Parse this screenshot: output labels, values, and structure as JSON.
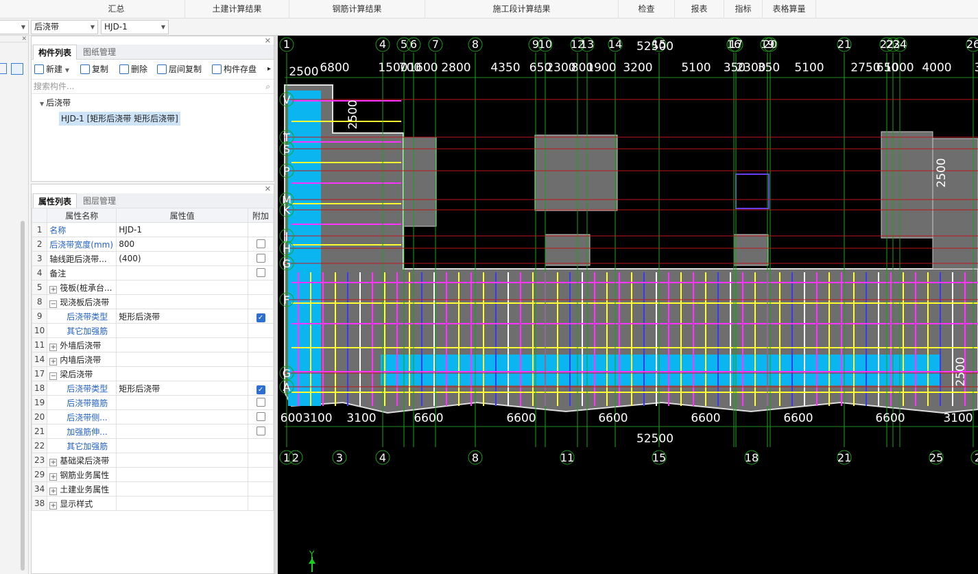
{
  "menu": [
    "汇总",
    "土建计算结果",
    "钢筋计算结果",
    "施工段计算结果",
    "检查",
    "报表",
    "指标",
    "表格算量"
  ],
  "toolbar2": {
    "combo1": "",
    "combo2": "后浇带",
    "combo3": "HJD-1"
  },
  "component_panel": {
    "tabs": [
      "构件列表",
      "图纸管理"
    ],
    "buttons": [
      "新建",
      "复制",
      "删除",
      "层间复制",
      "构件存盘"
    ],
    "search_placeholder": "搜索构件...",
    "tree_root": "后浇带",
    "tree_child": "HJD-1 [矩形后浇带 矩形后浇带]"
  },
  "property_panel": {
    "tabs": [
      "属性列表",
      "图层管理"
    ],
    "headers": [
      "属性名称",
      "属性值",
      "附加"
    ],
    "rows": [
      {
        "n": "1",
        "name": "名称",
        "value": "HJD-1",
        "blue": true,
        "indent": false,
        "exp": "",
        "cb": null
      },
      {
        "n": "2",
        "name": "后浇带宽度(mm)",
        "value": "800",
        "blue": true,
        "indent": false,
        "exp": "",
        "cb": false
      },
      {
        "n": "3",
        "name": "轴线距后浇带...",
        "value": "(400)",
        "blue": false,
        "indent": false,
        "exp": "",
        "cb": false
      },
      {
        "n": "4",
        "name": "备注",
        "value": "",
        "blue": false,
        "indent": false,
        "exp": "",
        "cb": false
      },
      {
        "n": "5",
        "name": "筏板(桩承台...",
        "value": "",
        "blue": false,
        "indent": false,
        "exp": "+",
        "cb": null
      },
      {
        "n": "8",
        "name": "现浇板后浇带",
        "value": "",
        "blue": false,
        "indent": false,
        "exp": "−",
        "cb": null
      },
      {
        "n": "9",
        "name": "后浇带类型",
        "value": "矩形后浇带",
        "blue": true,
        "indent": true,
        "exp": "",
        "cb": true
      },
      {
        "n": "10",
        "name": "其它加强筋",
        "value": "",
        "blue": true,
        "indent": true,
        "exp": "",
        "cb": null
      },
      {
        "n": "11",
        "name": "外墙后浇带",
        "value": "",
        "blue": false,
        "indent": false,
        "exp": "+",
        "cb": null
      },
      {
        "n": "14",
        "name": "内墙后浇带",
        "value": "",
        "blue": false,
        "indent": false,
        "exp": "+",
        "cb": null
      },
      {
        "n": "17",
        "name": "梁后浇带",
        "value": "",
        "blue": false,
        "indent": false,
        "exp": "−",
        "cb": null
      },
      {
        "n": "18",
        "name": "后浇带类型",
        "value": "矩形后浇带",
        "blue": true,
        "indent": true,
        "exp": "",
        "cb": true
      },
      {
        "n": "19",
        "name": "后浇带箍筋",
        "value": "",
        "blue": true,
        "indent": true,
        "exp": "",
        "cb": false
      },
      {
        "n": "20",
        "name": "后浇带侧...",
        "value": "",
        "blue": true,
        "indent": true,
        "exp": "",
        "cb": false
      },
      {
        "n": "21",
        "name": "加强筋伸...",
        "value": "",
        "blue": true,
        "indent": true,
        "exp": "",
        "cb": false
      },
      {
        "n": "22",
        "name": "其它加强筋",
        "value": "",
        "blue": true,
        "indent": true,
        "exp": "",
        "cb": null
      },
      {
        "n": "23",
        "name": "基础梁后浇带",
        "value": "",
        "blue": false,
        "indent": false,
        "exp": "+",
        "cb": null
      },
      {
        "n": "29",
        "name": "钢筋业务属性",
        "value": "",
        "blue": false,
        "indent": false,
        "exp": "+",
        "cb": null
      },
      {
        "n": "34",
        "name": "土建业务属性",
        "value": "",
        "blue": false,
        "indent": false,
        "exp": "+",
        "cb": null
      },
      {
        "n": "38",
        "name": "显示样式",
        "value": "",
        "blue": false,
        "indent": false,
        "exp": "+",
        "cb": null
      }
    ]
  },
  "canvas": {
    "top_axes": [
      "1",
      "4",
      "5",
      "6",
      "7",
      "8",
      "9",
      "10",
      "12",
      "13",
      "14",
      "15",
      "16",
      "17",
      "19",
      "20",
      "21",
      "22",
      "23",
      "24",
      "26"
    ],
    "top_dims": [
      "6800",
      "1500",
      "700",
      "1600",
      "2800",
      "4350",
      "650",
      "2300",
      "800",
      "1900",
      "3200",
      "5100",
      "350",
      "2300",
      "350",
      "5100",
      "2750",
      "650",
      "1000",
      "4000",
      "3"
    ],
    "top_total": "52500",
    "bottom_axes": [
      "1",
      "2",
      "3",
      "4",
      "8",
      "11",
      "15",
      "18",
      "21",
      "25",
      "2"
    ],
    "bottom_dims": [
      "600",
      "3100",
      "3100",
      "6600",
      "6600",
      "6600",
      "6600",
      "6600",
      "6600",
      "3100"
    ],
    "bottom_total": "52500",
    "left_axes": [
      "V",
      "T",
      "S",
      "P",
      "M",
      "K",
      "J",
      "H",
      "G",
      "F",
      "G",
      "A"
    ],
    "side_dims": [
      "2500",
      "2500",
      "2500",
      "2500"
    ],
    "y_label": "Y"
  }
}
